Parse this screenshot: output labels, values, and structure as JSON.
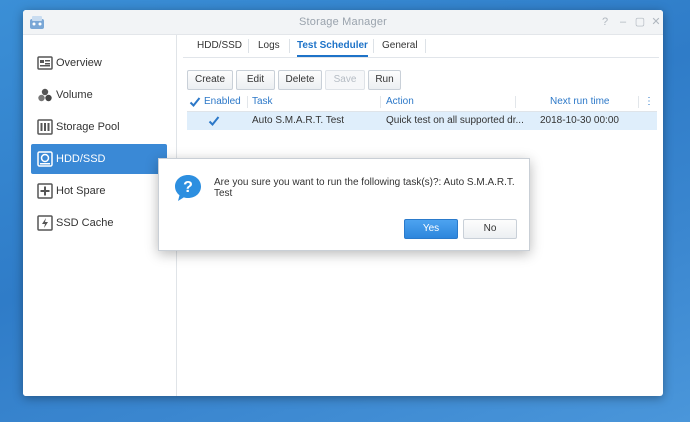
{
  "window": {
    "title": "Storage Manager"
  },
  "sidebar": {
    "items": [
      {
        "label": "Overview",
        "icon": "overview-icon"
      },
      {
        "label": "Volume",
        "icon": "volume-icon"
      },
      {
        "label": "Storage Pool",
        "icon": "storage-pool-icon"
      },
      {
        "label": "HDD/SSD",
        "icon": "hdd-icon",
        "active": true
      },
      {
        "label": "Hot Spare",
        "icon": "hot-spare-icon"
      },
      {
        "label": "SSD Cache",
        "icon": "ssd-cache-icon"
      }
    ]
  },
  "tabs": [
    {
      "label": "HDD/SSD"
    },
    {
      "label": "Logs"
    },
    {
      "label": "Test Scheduler",
      "active": true
    },
    {
      "label": "General"
    }
  ],
  "toolbar": {
    "create": "Create",
    "edit": "Edit",
    "delete": "Delete",
    "save": "Save",
    "run": "Run"
  },
  "grid": {
    "columns": [
      "Enabled",
      "Task",
      "Action",
      "Next run time"
    ],
    "rows": [
      {
        "enabled": true,
        "task": "Auto S.M.A.R.T. Test",
        "action": "Quick test on all supported dr...",
        "next_run": "2018-10-30 00:00"
      }
    ]
  },
  "dialog": {
    "message": "Are you sure you want to run the following task(s)?: Auto S.M.A.R.T. Test",
    "yes": "Yes",
    "no": "No"
  },
  "colors": {
    "accent": "#1e73c8",
    "active_sidebar": "#3a89d6",
    "desktop": "#2f7cc8"
  }
}
